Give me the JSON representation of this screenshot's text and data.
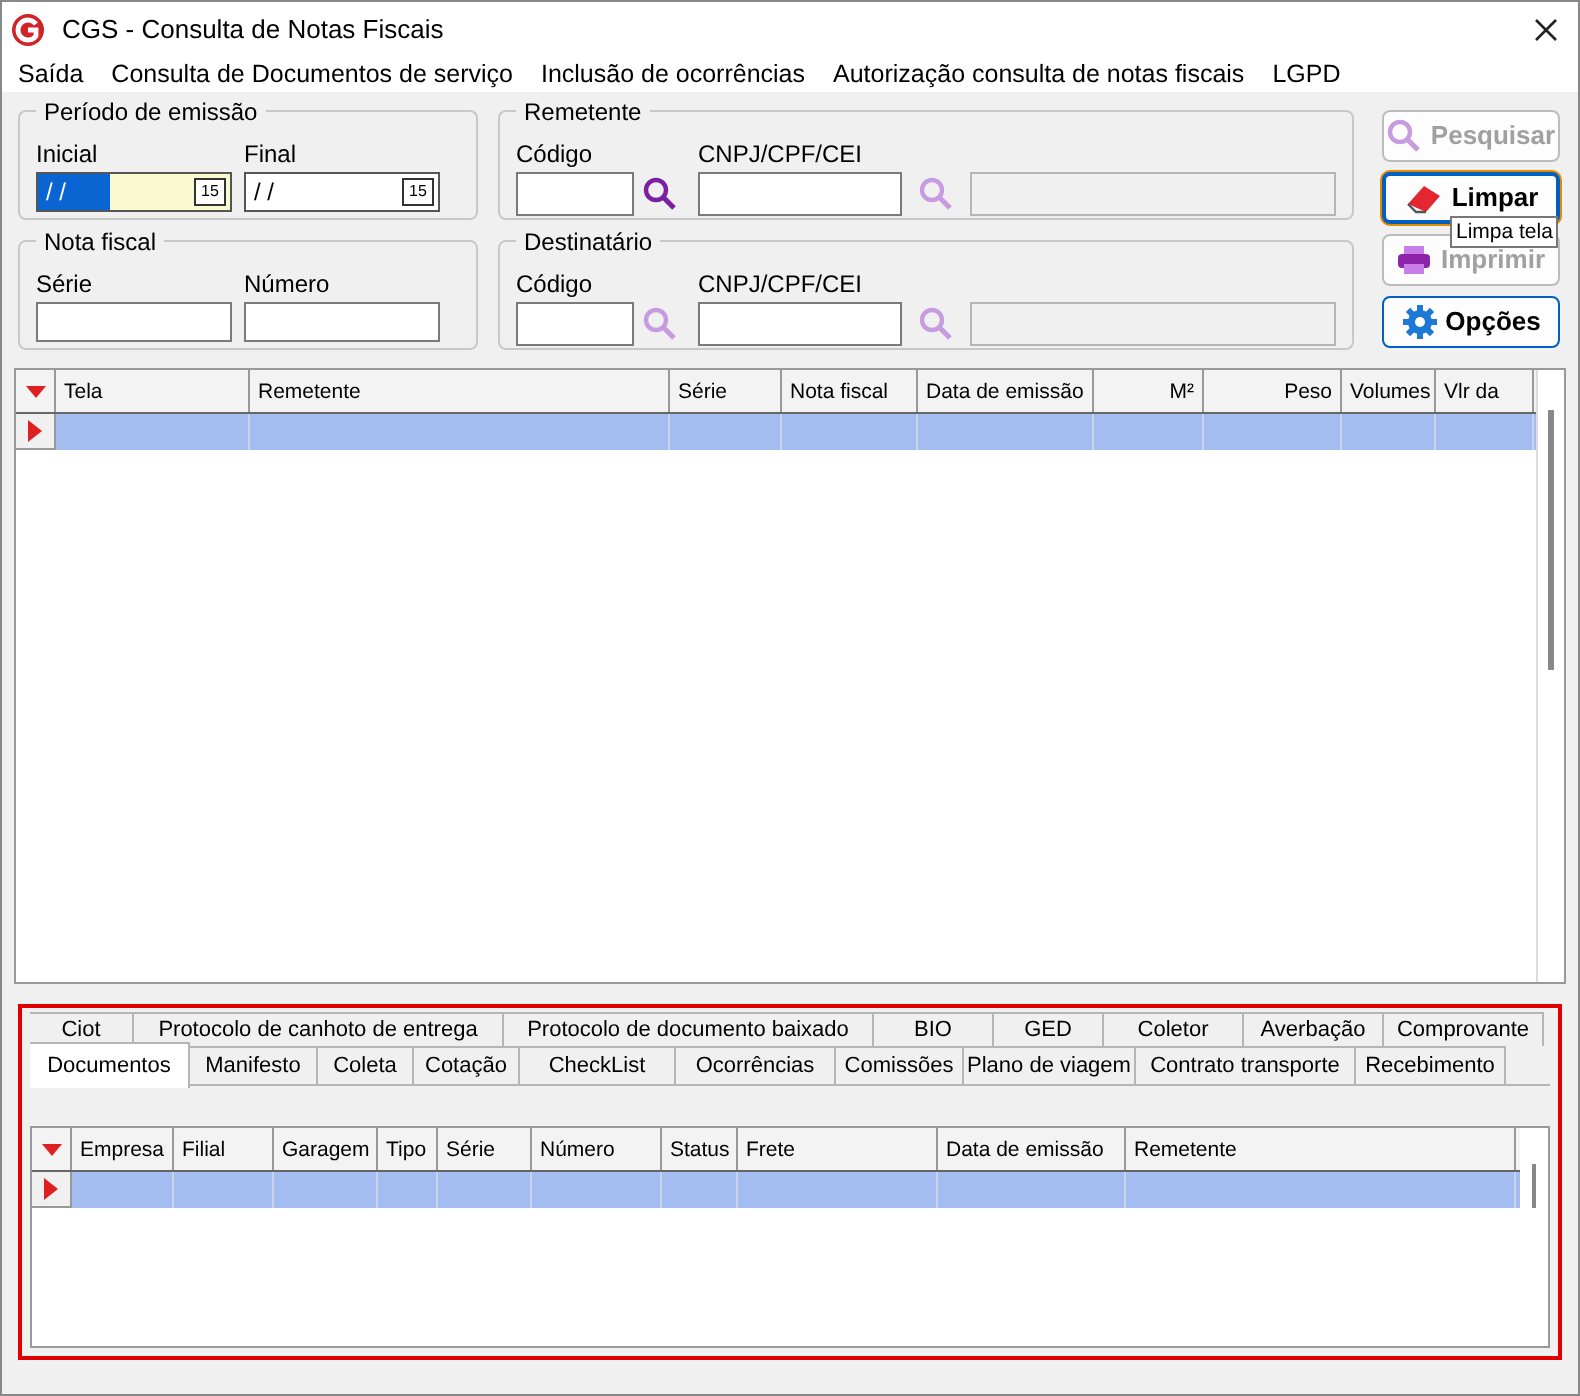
{
  "window": {
    "title": "CGS - Consulta de Notas Fiscais"
  },
  "menu": [
    "Saída",
    "Consulta de Documentos de serviço",
    "Inclusão de ocorrências",
    "Autorização consulta de notas fiscais",
    "LGPD"
  ],
  "periodo": {
    "title": "Período de emissão",
    "fields": [
      {
        "label": "Inicial",
        "value": "/ /",
        "focused": true,
        "button": "15"
      },
      {
        "label": "Final",
        "value": "/ /",
        "focused": false,
        "button": "15"
      }
    ]
  },
  "nota_fiscal": {
    "title": "Nota fiscal",
    "fields": [
      {
        "label": "Série"
      },
      {
        "label": "Número"
      }
    ]
  },
  "remetente": {
    "title": "Remetente",
    "code_label": "Código",
    "doc_label": "CNPJ/CPF/CEI",
    "code_search_enabled": true,
    "doc_search_enabled": false
  },
  "destinatario": {
    "title": "Destinatário",
    "code_label": "Código",
    "doc_label": "CNPJ/CPF/CEI",
    "code_search_enabled": false,
    "doc_search_enabled": false
  },
  "buttons": [
    {
      "kind": "search",
      "label": "Pesquisar",
      "disabled": true,
      "focused": false
    },
    {
      "kind": "clear",
      "label": "Limpar",
      "disabled": false,
      "focused": true
    },
    {
      "kind": "print",
      "label": "Imprimir",
      "disabled": true,
      "focused": false
    },
    {
      "kind": "options",
      "label": "Opções",
      "disabled": false,
      "focused": false
    }
  ],
  "tooltip": "Limpa tela",
  "grid": {
    "columns": [
      {
        "label": "Tela",
        "kind": "text"
      },
      {
        "label": "Remetente",
        "kind": "text"
      },
      {
        "label": "Série",
        "kind": "text"
      },
      {
        "label": "Nota fiscal",
        "kind": "text"
      },
      {
        "label": "Data de emissão",
        "kind": "text"
      },
      {
        "label": "M²",
        "kind": "numeric"
      },
      {
        "label": "Peso",
        "kind": "numeric"
      },
      {
        "label": "Volumes",
        "kind": "text"
      },
      {
        "label": "Vlr da",
        "kind": "text"
      }
    ],
    "rows": [
      {
        "selected": true
      }
    ]
  },
  "tabs": {
    "row_1": [
      {
        "label": "Ciot"
      },
      {
        "label": "Protocolo de canhoto de entrega"
      },
      {
        "label": "Protocolo de documento baixado"
      },
      {
        "label": "BIO"
      },
      {
        "label": "GED"
      },
      {
        "label": "Coletor"
      },
      {
        "label": "Averbação"
      },
      {
        "label": "Comprovante"
      }
    ],
    "row_2": [
      {
        "label": "Documentos",
        "selected": true
      },
      {
        "label": "Manifesto",
        "selected": false
      },
      {
        "label": "Coleta",
        "selected": false
      },
      {
        "label": "Cotação",
        "selected": false
      },
      {
        "label": "CheckList",
        "selected": false
      },
      {
        "label": "Ocorrências",
        "selected": false
      },
      {
        "label": "Comissões",
        "selected": false
      },
      {
        "label": "Plano de viagem",
        "selected": false
      },
      {
        "label": "Contrato transporte",
        "selected": false
      },
      {
        "label": "Recebimento",
        "selected": false
      }
    ]
  },
  "sub_grid": {
    "columns": [
      "Empresa",
      "Filial",
      "Garagem",
      "Tipo",
      "Série",
      "Número",
      "Status",
      "Frete",
      "Data de emissão",
      "Remetente"
    ],
    "rows": [
      {
        "selected": true
      }
    ]
  }
}
